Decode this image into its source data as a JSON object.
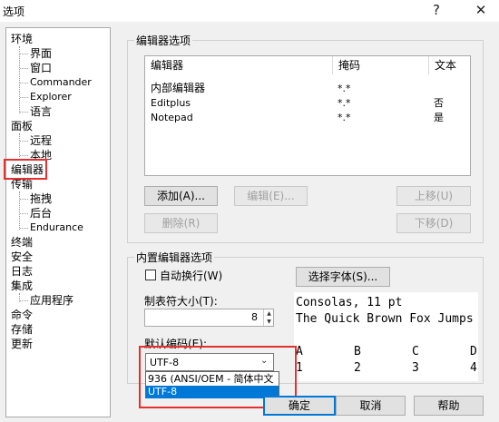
{
  "window": {
    "title": "选项",
    "help_icon": "?",
    "close_icon": "✕"
  },
  "tree": {
    "environment": "环境",
    "env_children": [
      "界面",
      "窗口",
      "Commander",
      "Explorer",
      "语言"
    ],
    "panel": "面板",
    "panel_children": [
      "远程",
      "本地"
    ],
    "editor": "编辑器",
    "transfer": "传输",
    "transfer_children": [
      "拖拽",
      "后台",
      "Endurance"
    ],
    "misc_top": [
      "终端",
      "安全",
      "日志"
    ],
    "integration": "集成",
    "integration_children": [
      "应用程序"
    ],
    "misc_bottom": [
      "命令",
      "存储",
      "更新"
    ]
  },
  "editors_group": {
    "label": "编辑器选项",
    "columns": [
      "编辑器",
      "掩码",
      "文本"
    ],
    "rows": [
      {
        "editor": "内部编辑器",
        "mask": "*.*",
        "text": ""
      },
      {
        "editor": "Editplus",
        "mask": "*.*",
        "text": "否"
      },
      {
        "editor": "Notepad",
        "mask": "*.*",
        "text": "是"
      }
    ],
    "buttons": {
      "add": "添加(A)...",
      "edit": "编辑(E)...",
      "move_up": "上移(U)",
      "delete": "删除(R)",
      "move_down": "下移(D)"
    }
  },
  "internal_group": {
    "label": "内置编辑器选项",
    "word_wrap": "自动换行(W)",
    "select_font": "选择字体(S)...",
    "tab_size_label": "制表符大小(T):",
    "tab_size_value": "8",
    "encoding_label": "默认编码(E):",
    "encoding_value": "UTF-8",
    "encoding_options": [
      "936  (ANSI/OEM - 简体中文",
      "UTF-8"
    ],
    "font_preview": {
      "line1": "Consolas, 11 pt",
      "line2": "The Quick Brown Fox Jumps",
      "headers": [
        "A",
        "B",
        "C",
        "D"
      ],
      "values": [
        "1",
        "2",
        "3",
        "4"
      ]
    }
  },
  "footer": {
    "ok": "确定",
    "cancel": "取消",
    "help": "帮助"
  },
  "colors": {
    "highlight": "#0078d7",
    "annotation_red": "#e5302f"
  }
}
